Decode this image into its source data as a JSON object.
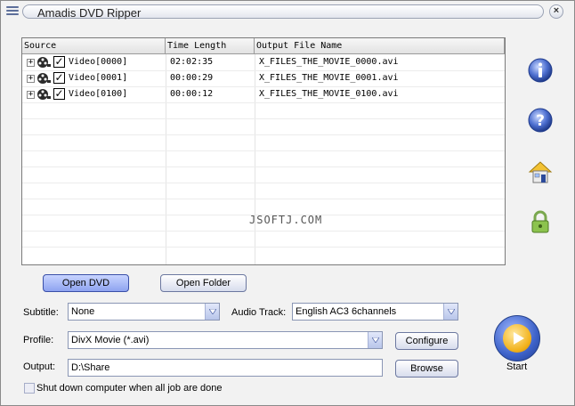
{
  "window": {
    "title": "Amadis DVD Ripper",
    "close_label": "×"
  },
  "table": {
    "columns": [
      "Source",
      "Time Length",
      "Output File Name"
    ],
    "rows": [
      {
        "source": "Video[0000]",
        "time": "02:02:35",
        "output": "X_FILES_THE_MOVIE_0000.avi",
        "checked": true
      },
      {
        "source": "Video[0001]",
        "time": "00:00:29",
        "output": "X_FILES_THE_MOVIE_0001.avi",
        "checked": true
      },
      {
        "source": "Video[0100]",
        "time": "00:00:12",
        "output": "X_FILES_THE_MOVIE_0100.avi",
        "checked": true
      }
    ],
    "watermark": "JSOFTJ.COM"
  },
  "side_icons": [
    "info-icon",
    "help-icon",
    "home-icon",
    "lock-icon"
  ],
  "buttons": {
    "open_dvd": "Open DVD",
    "open_folder": "Open Folder",
    "configure": "Configure",
    "browse": "Browse",
    "start": "Start"
  },
  "form": {
    "subtitle_label": "Subtitle:",
    "subtitle_value": "None",
    "audio_label": "Audio Track:",
    "audio_value": "English AC3 6channels",
    "profile_label": "Profile:",
    "profile_value": "DivX Movie (*.avi)",
    "output_label": "Output:",
    "output_value": "D:\\Share"
  },
  "shutdown": {
    "label": "Shut down computer when all job are done",
    "checked": false
  },
  "colors": {
    "accent_blue": "#3d62c9",
    "start_gold": "#f2b21c"
  }
}
